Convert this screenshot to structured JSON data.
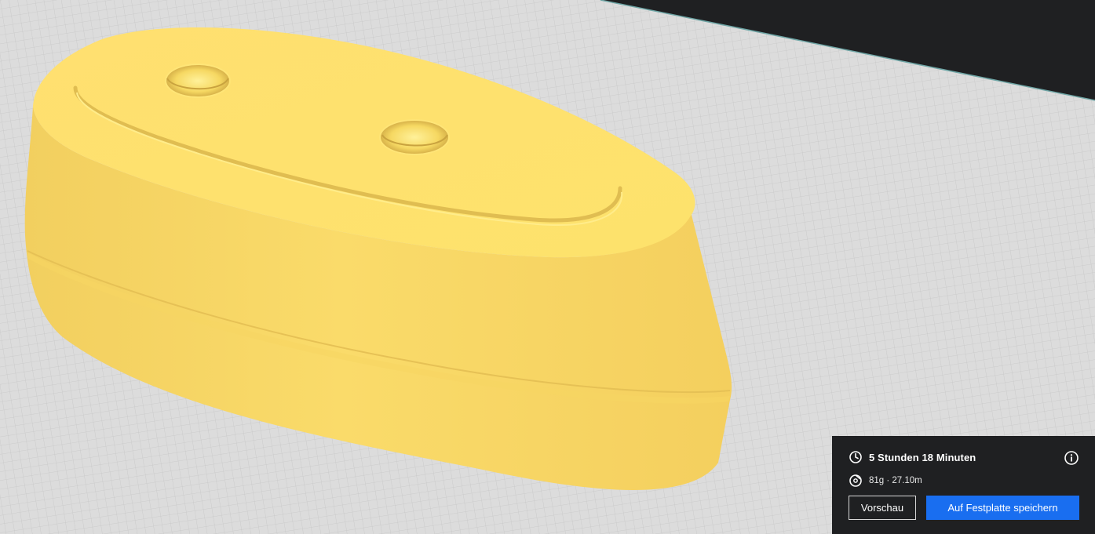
{
  "print_summary": {
    "time": "5 Stunden 18 Minuten",
    "material": "81g · 27.10m",
    "time_icon": "clock-icon",
    "material_icon": "filament-spool-icon",
    "info_icon": "info-icon"
  },
  "actions": {
    "preview_label": "Vorschau",
    "save_label": "Auf Festplatte speichern"
  },
  "colors": {
    "build_plate": "#dcdcdc",
    "build_plate_grid": "#c4c4c4",
    "background": "#1f2022",
    "model": "#ffe16b",
    "model_shadow": "#e8c557",
    "accent_button": "#196ef0"
  }
}
